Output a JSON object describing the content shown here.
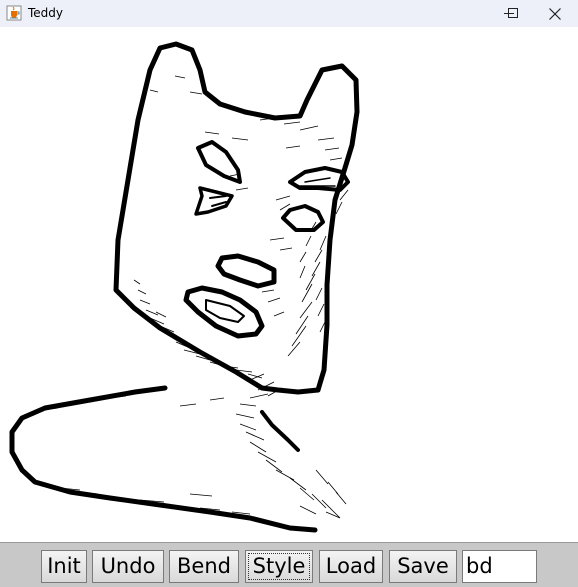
{
  "window": {
    "title": "Teddy",
    "icon": "java-cup-icon",
    "controls": [
      "minimize-icon",
      "maximize-icon",
      "close-icon"
    ]
  },
  "canvas": {
    "content": "hand-drawn teddy bear model with hatched shading",
    "colors": {
      "stroke": "#000000",
      "background": "#ffffff"
    }
  },
  "toolbar": {
    "init_label": "Init",
    "undo_label": "Undo",
    "bend_label": "Bend",
    "style_label": "Style",
    "load_label": "Load",
    "save_label": "Save",
    "filename_value": "bd"
  }
}
